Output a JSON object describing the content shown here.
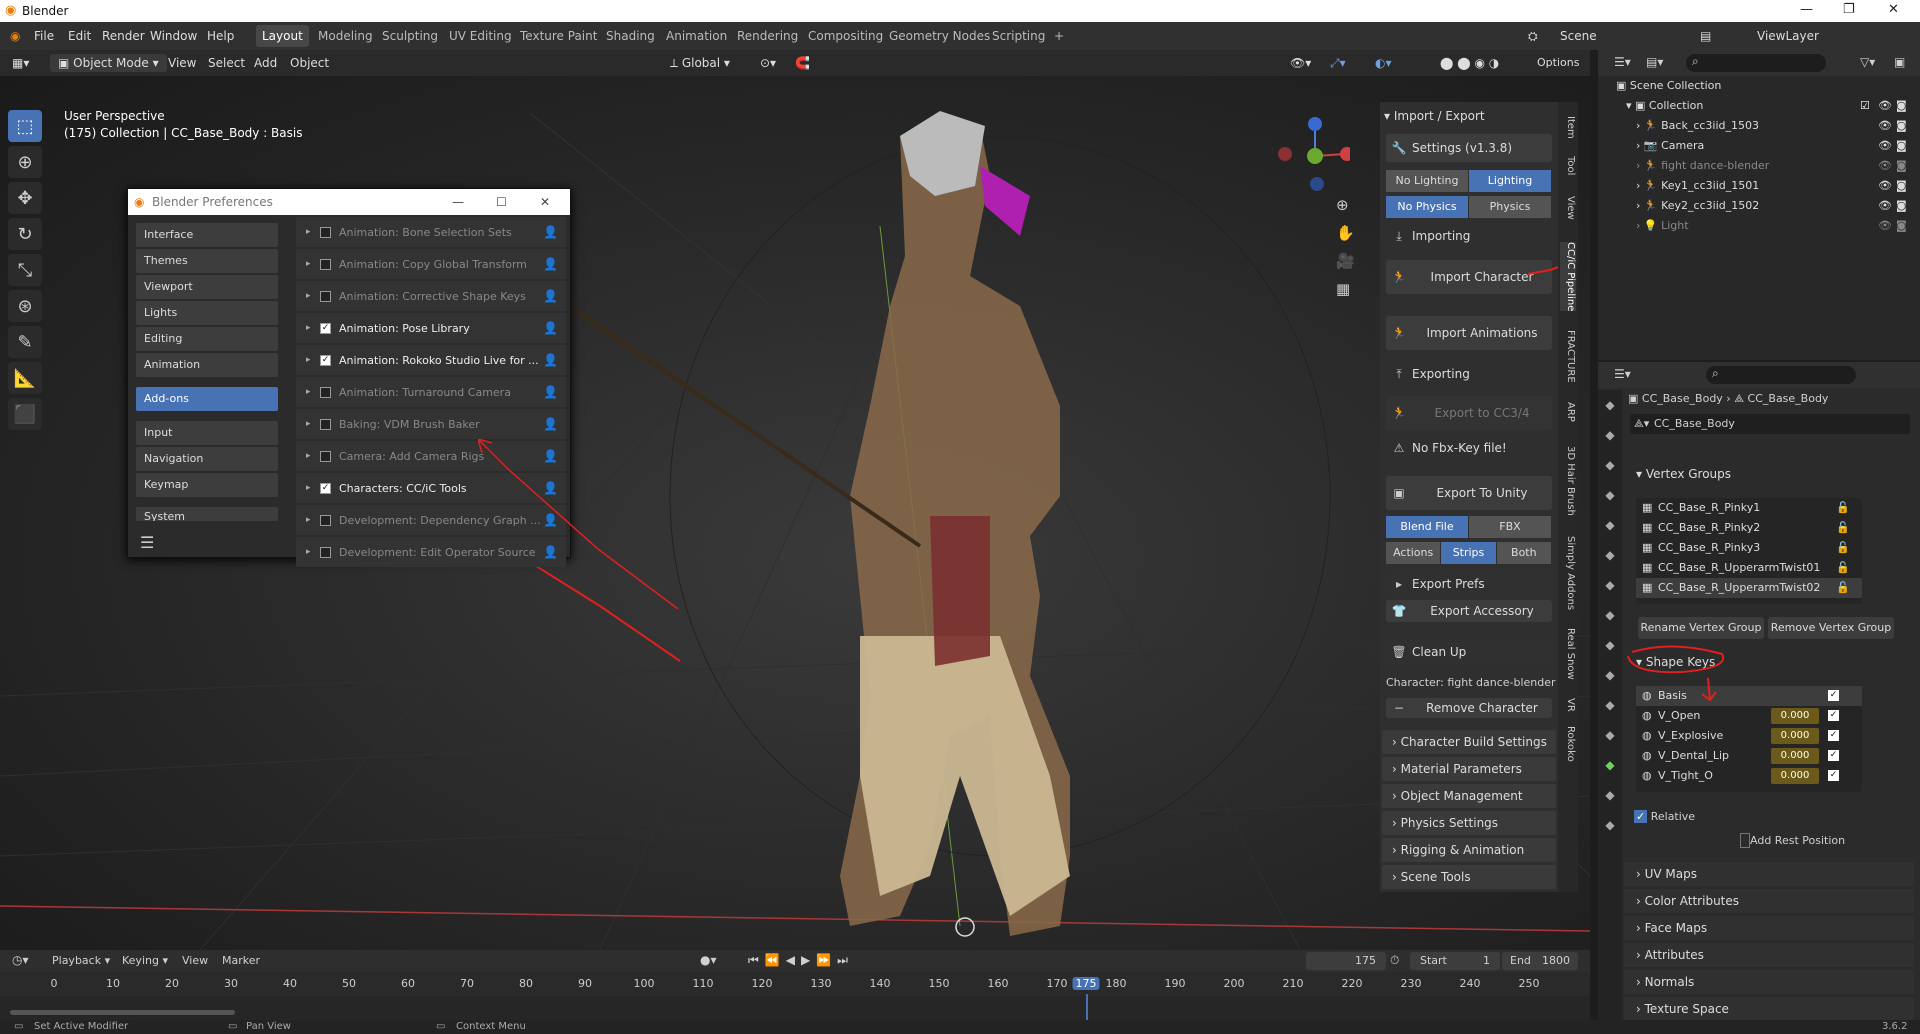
{
  "window": {
    "title": "Blender",
    "minimize": "—",
    "maximize": "❐",
    "close": "✕"
  },
  "menu": [
    "File",
    "Edit",
    "Render",
    "Window",
    "Help"
  ],
  "workspaces": [
    "Layout",
    "Modeling",
    "Sculpting",
    "UV Editing",
    "Texture Paint",
    "Shading",
    "Animation",
    "Rendering",
    "Compositing",
    "Geometry Nodes",
    "Scripting",
    "+"
  ],
  "active_workspace": "Layout",
  "scene": "Scene",
  "view_layer": "ViewLayer",
  "viewport_header": {
    "mode": "Object Mode",
    "menus": [
      "View",
      "Select",
      "Add",
      "Object"
    ],
    "orientation": "Global",
    "options": "Options"
  },
  "viewport_info": {
    "line1": "User Perspective",
    "line2": "(175) Collection | CC_Base_Body : Basis"
  },
  "prefs": {
    "title": "Blender Preferences",
    "nav": [
      "Interface",
      "Themes",
      "Viewport",
      "Lights",
      "Editing",
      "Animation",
      "Add-ons",
      "Input",
      "Navigation",
      "Keymap",
      "System"
    ],
    "active_nav": "Add-ons",
    "addons": [
      {
        "label": "Animation: Bone Selection Sets",
        "enabled": false
      },
      {
        "label": "Animation: Copy Global Transform",
        "enabled": false
      },
      {
        "label": "Animation: Corrective Shape Keys",
        "enabled": false
      },
      {
        "label": "Animation: Pose Library",
        "enabled": true
      },
      {
        "label": "Animation: Rokoko Studio Live for ...",
        "enabled": true
      },
      {
        "label": "Animation: Turnaround Camera",
        "enabled": false
      },
      {
        "label": "Baking: VDM Brush Baker",
        "enabled": false
      },
      {
        "label": "Camera: Add Camera Rigs",
        "enabled": false
      },
      {
        "label": "Characters: CC/iC Tools",
        "enabled": true
      },
      {
        "label": "Development: Dependency Graph ...",
        "enabled": false
      },
      {
        "label": "Development: Edit Operator Source",
        "enabled": false
      }
    ]
  },
  "npanel": {
    "header": "Import / Export",
    "settings": "Settings  (v1.3.8)",
    "lighting": [
      "No Lighting",
      "Lighting"
    ],
    "physics": [
      "No Physics",
      "Physics"
    ],
    "importing": "Importing",
    "import_character": "Import Character",
    "import_animations": "Import Animations",
    "exporting": "Exporting",
    "export_cc": "Export to CC3/4",
    "no_fbx": "No Fbx-Key file!",
    "export_unity": "Export To Unity",
    "format": [
      "Blend File",
      "FBX"
    ],
    "actions": [
      "Actions",
      "Strips",
      "Both"
    ],
    "export_prefs": "Export Prefs",
    "export_accessory": "Export Accessory",
    "clean_up": "Clean Up",
    "character": "Character: fight dance-blender",
    "remove_character": "Remove Character",
    "collapsed": [
      "Character Build Settings",
      "Material Parameters",
      "Object Management",
      "Physics Settings",
      "Rigging & Animation",
      "Scene Tools"
    ],
    "tabs": [
      "Item",
      "Tool",
      "View",
      "CC/iC Pipeline",
      "FRACTURE",
      "ARP",
      "3D Hair Brush",
      "Simply Addons",
      "Real Snow",
      "VR",
      "Rokoko"
    ]
  },
  "outliner": {
    "root": "Scene Collection",
    "collection": "Collection",
    "items": [
      "Back_cc3iid_1503",
      "Camera",
      "fight dance-blender",
      "Key1_cc3iid_1501",
      "Key2_cc3iid_1502",
      "Light"
    ]
  },
  "properties": {
    "object": "CC_Base_Body",
    "mesh": "CC_Base_Body",
    "data_name": "CC_Base_Body",
    "vertex_groups_title": "Vertex Groups",
    "vertex_groups": [
      "CC_Base_R_Pinky1",
      "CC_Base_R_Pinky2",
      "CC_Base_R_Pinky3",
      "CC_Base_R_UpperarmTwist01",
      "CC_Base_R_UpperarmTwist02"
    ],
    "rename_vg": "Rename Vertex Group",
    "remove_vg": "Remove Vertex Group",
    "shape_keys_title": "Shape Keys",
    "shape_keys": [
      {
        "name": "Basis",
        "value": ""
      },
      {
        "name": "V_Open",
        "value": "0.000"
      },
      {
        "name": "V_Explosive",
        "value": "0.000"
      },
      {
        "name": "V_Dental_Lip",
        "value": "0.000"
      },
      {
        "name": "V_Tight_O",
        "value": "0.000"
      }
    ],
    "relative": "Relative",
    "add_rest": "Add Rest Position",
    "sections": [
      "UV Maps",
      "Color Attributes",
      "Face Maps",
      "Attributes",
      "Normals",
      "Texture Space"
    ]
  },
  "timeline": {
    "menus": [
      "Playback",
      "Keying",
      "View",
      "Marker"
    ],
    "current_frame": "175",
    "start_label": "Start",
    "start": "1",
    "end_label": "End",
    "end": "1800",
    "ticks": [
      "0",
      "10",
      "20",
      "30",
      "40",
      "50",
      "60",
      "70",
      "80",
      "90",
      "100",
      "110",
      "120",
      "130",
      "140",
      "150",
      "160",
      "170",
      "175",
      "180",
      "190",
      "200",
      "210",
      "220",
      "230",
      "240",
      "250"
    ]
  },
  "status": {
    "left": "Set Active Modifier",
    "mid": "Pan View",
    "right": "Context Menu",
    "version": "3.6.2"
  },
  "colors": {
    "accent": "#4772b3",
    "annotation": "#e0201e",
    "shape_value": "#6b5a1a"
  }
}
